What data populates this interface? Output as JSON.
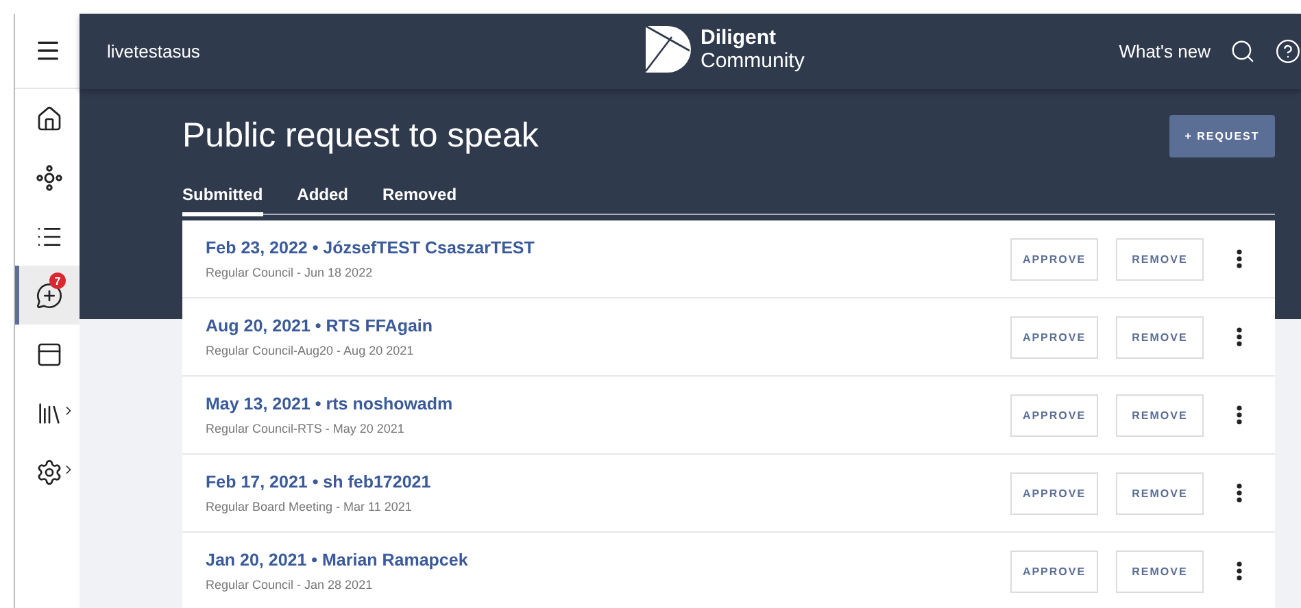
{
  "header": {
    "org": "livetestasus",
    "logo": {
      "line1": "Diligent",
      "line2": "Community"
    },
    "whats_new": "What's new"
  },
  "sidebar": {
    "items": [
      {
        "kind": "home",
        "selected": false,
        "expandable": false
      },
      {
        "kind": "network",
        "selected": false,
        "expandable": false
      },
      {
        "kind": "list",
        "selected": false,
        "expandable": false
      },
      {
        "kind": "chat",
        "selected": true,
        "expandable": false,
        "badge": "7"
      },
      {
        "kind": "panel",
        "selected": false,
        "expandable": false
      },
      {
        "kind": "books",
        "selected": false,
        "expandable": true
      },
      {
        "kind": "settings",
        "selected": false,
        "expandable": true
      }
    ]
  },
  "page": {
    "title": "Public request to speak",
    "request_button": "+ REQUEST",
    "tabs": [
      {
        "label": "Submitted",
        "selected": true
      },
      {
        "label": "Added",
        "selected": false
      },
      {
        "label": "Removed",
        "selected": false
      }
    ],
    "requests": [
      {
        "title": "Feb 23, 2022 • JózsefTEST CsaszarTEST",
        "meeting": "Regular Council - Jun 18 2022",
        "approve": "APPROVE",
        "remove": "REMOVE"
      },
      {
        "title": "Aug 20, 2021 • RTS FFAgain",
        "meeting": "Regular Council-Aug20 - Aug 20 2021",
        "approve": "APPROVE",
        "remove": "REMOVE"
      },
      {
        "title": "May 13, 2021 • rts noshowadm",
        "meeting": "Regular Council-RTS - May 20 2021",
        "approve": "APPROVE",
        "remove": "REMOVE"
      },
      {
        "title": "Feb 17, 2021 • sh feb172021",
        "meeting": "Regular Board Meeting - Mar 11 2021",
        "approve": "APPROVE",
        "remove": "REMOVE"
      },
      {
        "title": "Jan 20, 2021 • Marian Ramapcek",
        "meeting": "Regular Council - Jan 28 2021",
        "approve": "APPROVE",
        "remove": "REMOVE"
      }
    ]
  }
}
